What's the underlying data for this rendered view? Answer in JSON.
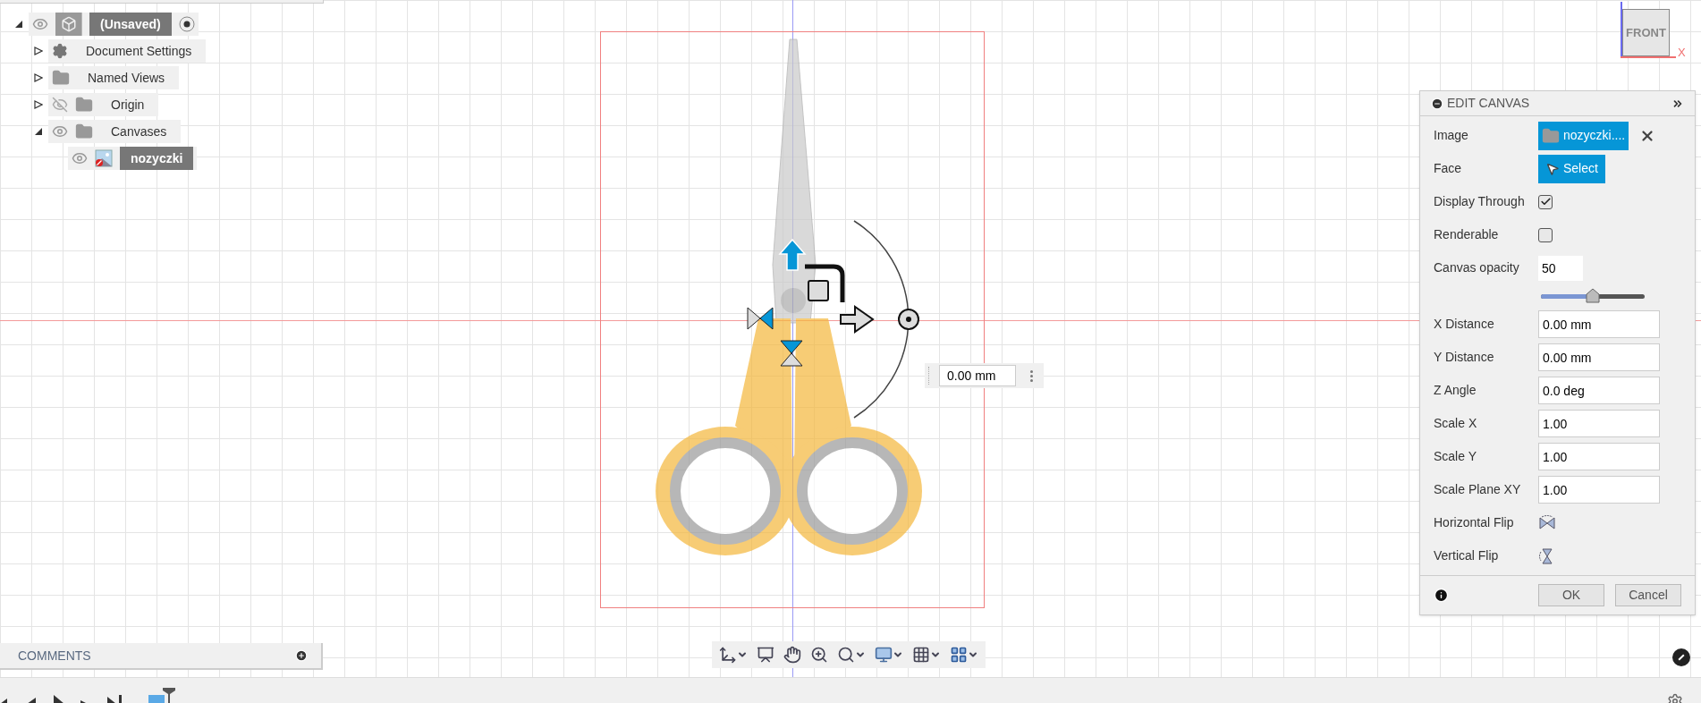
{
  "browser": {
    "root": {
      "label": "(Unsaved)",
      "kind": "document",
      "expanded": true,
      "visible": true,
      "selected": true,
      "children": [
        {
          "label": "Document Settings",
          "kind": "settings",
          "expanded": false,
          "selected": false
        },
        {
          "label": "Named Views",
          "kind": "folder",
          "expanded": false,
          "selected": false
        },
        {
          "label": "Origin",
          "kind": "folder",
          "expanded": false,
          "visible": false,
          "selected": false
        },
        {
          "label": "Canvases",
          "kind": "folder",
          "expanded": true,
          "visible": true,
          "selected": false,
          "children": [
            {
              "label": "nozyczki",
              "kind": "canvas",
              "visible": true,
              "selected": true
            }
          ]
        }
      ]
    }
  },
  "viewport": {
    "dimension_input": "0.00 mm",
    "viewcube": {
      "face": "FRONT",
      "axis": "X"
    }
  },
  "edit_canvas": {
    "title": "EDIT CANVAS",
    "rows": [
      {
        "kind": "file",
        "label": "Image",
        "value": "nozyczki...."
      },
      {
        "kind": "select",
        "label": "Face",
        "value": "Select"
      },
      {
        "kind": "checkbox",
        "label": "Display Through",
        "checked": true
      },
      {
        "kind": "checkbox",
        "label": "Renderable",
        "checked": false
      },
      {
        "kind": "slider",
        "label": "Canvas opacity",
        "value": "50",
        "level": 0.5
      },
      {
        "kind": "text",
        "label": "X Distance",
        "value": "0.00 mm"
      },
      {
        "kind": "text",
        "label": "Y Distance",
        "value": "0.00 mm"
      },
      {
        "kind": "text",
        "label": "Z Angle",
        "value": "0.0 deg"
      },
      {
        "kind": "text",
        "label": "Scale X",
        "value": "1.00"
      },
      {
        "kind": "text",
        "label": "Scale Y",
        "value": "1.00"
      },
      {
        "kind": "text",
        "label": "Scale Plane XY",
        "value": "1.00"
      },
      {
        "kind": "hflip",
        "label": "Horizontal Flip"
      },
      {
        "kind": "vflip",
        "label": "Vertical Flip"
      }
    ],
    "buttons": [
      "OK",
      "Cancel"
    ]
  },
  "comments": {
    "title": "COMMENTS"
  }
}
